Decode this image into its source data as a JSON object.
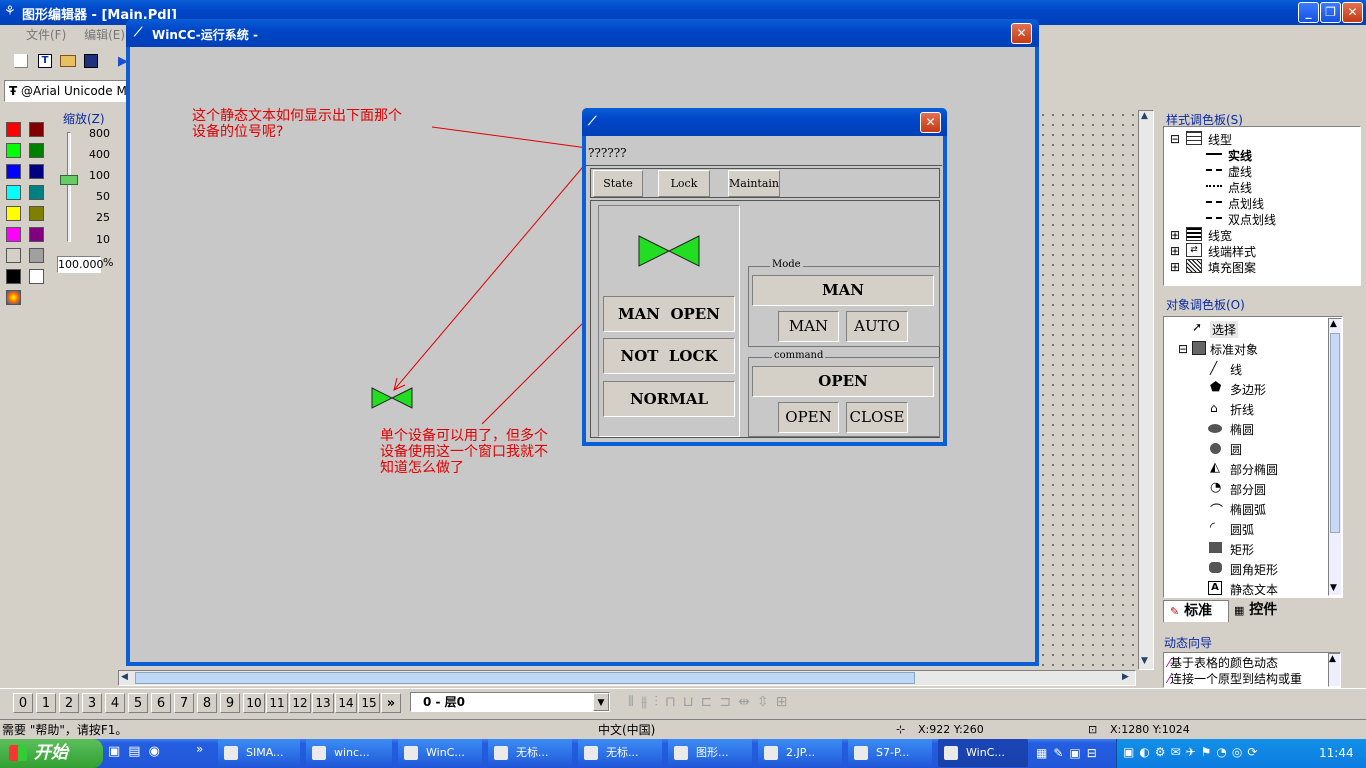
{
  "editor": {
    "title": "图形编辑器 - [Main.Pdl]",
    "menu": [
      "文件(F)",
      "编辑(E)"
    ],
    "font_box": "@Arial Unicode M",
    "zoom_label": "缩放(Z)",
    "zoom_ticks": [
      "800",
      "400",
      "100",
      "50",
      "25",
      "10"
    ],
    "zoom_value": "100.000",
    "zoom_unit": "%",
    "status_help": "需要 \"帮助\"，请按F1。",
    "status_lang": "中文(中国)",
    "status_pos": "X:922 Y:260",
    "status_size": "X:1280 Y:1024",
    "layer_buttons": [
      "0",
      "1",
      "2",
      "3",
      "4",
      "5",
      "6",
      "7",
      "8",
      "9",
      "10",
      "11",
      "12",
      "13",
      "14",
      "15"
    ],
    "layer_more": "»",
    "layer_select": "0 - 层0"
  },
  "style_palette": {
    "title": "样式调色板(S)",
    "root": "线型",
    "items": [
      "实线",
      "虚线",
      "点线",
      "点划线",
      "双点划线"
    ],
    "others": [
      "线宽",
      "线端样式",
      "填充图案"
    ]
  },
  "object_palette": {
    "title": "对象调色板(O)",
    "select": "选择",
    "group": "标准对象",
    "items": [
      "线",
      "多边形",
      "折线",
      "椭圆",
      "圆",
      "部分椭圆",
      "部分圆",
      "椭圆弧",
      "圆弧",
      "矩形",
      "圆角矩形",
      "静态文本"
    ],
    "tab_standard": "标准",
    "tab_controls": "控件"
  },
  "dynamic_wizard": {
    "title": "动态向导",
    "items": [
      "基于表格的颜色动态",
      "连接一个原型到结构或重"
    ]
  },
  "runtime": {
    "title": "WinCC-运行系统 -",
    "annotation1": [
      "这个静态文本如何显示出下面那个",
      "设备的位号呢?"
    ],
    "annotation2": [
      "单个设备可以用了，但多个",
      "设备使用这一个窗口我就不",
      "知道怎么做了"
    ]
  },
  "faceplate": {
    "tag": "??????",
    "tabs": [
      "State",
      "Lock",
      "Maintain"
    ],
    "status": [
      "MAN  OPEN",
      "NOT  LOCK",
      "NORMAL"
    ],
    "mode_label": "Mode",
    "mode_value": "MAN",
    "mode_buttons": [
      "MAN",
      "AUTO"
    ],
    "command_label": "command",
    "command_value": "OPEN",
    "command_buttons": [
      "OPEN",
      "CLOSE"
    ]
  },
  "taskbar": {
    "start": "开始",
    "tasks": [
      "SIMA...",
      "winc...",
      "WinC...",
      "无标...",
      "无标...",
      "图形...",
      "2.JP...",
      "S7-P...",
      "WinC..."
    ],
    "clock": "11:44"
  },
  "colors": {
    "xp_blue": "#0a5ed6",
    "annotation": "#e00000",
    "valve_green": "#22dd22",
    "canvas_gray": "#c8c8c8"
  }
}
